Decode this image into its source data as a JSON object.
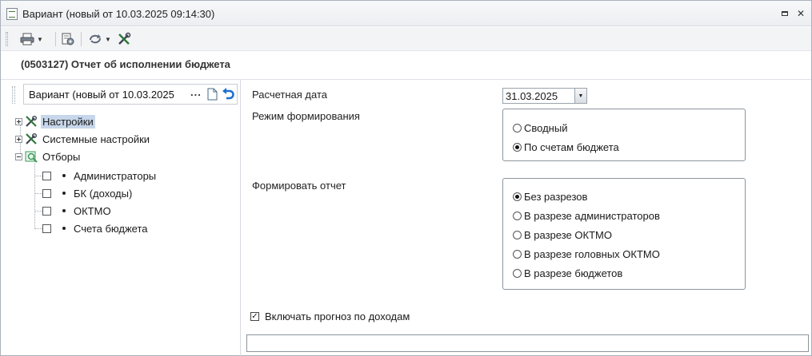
{
  "window": {
    "title": "Вариант (новый от 10.03.2025 09:14:30)",
    "restore_glyph": "▫",
    "close_glyph": "✕"
  },
  "toolbar": {
    "items": [
      {
        "icon": "printer-icon",
        "has_dropdown": true
      },
      {
        "icon": "settings-sheet-icon",
        "has_dropdown": false
      },
      {
        "icon": "refresh-options-icon",
        "has_dropdown": true
      },
      {
        "icon": "tools-icon",
        "has_dropdown": false
      }
    ]
  },
  "report": {
    "title": "(0503127) Отчет об исполнении бюджета"
  },
  "left_panel": {
    "variant_value": "Вариант (новый от 10.03.2025",
    "ellipsis": "...",
    "tree": [
      {
        "label": "Настройки",
        "icon": "tools-icon",
        "expandable": true,
        "selected": true
      },
      {
        "label": "Системные настройки",
        "icon": "tools-icon",
        "expandable": true,
        "selected": false
      },
      {
        "label": "Отборы",
        "icon": "filter-icon",
        "expandable": true,
        "expanded": true,
        "selected": false,
        "children": [
          {
            "label": "Администраторы",
            "checked": false
          },
          {
            "label": "БК (доходы)",
            "checked": false
          },
          {
            "label": "ОКТМО",
            "checked": false
          },
          {
            "label": "Счета бюджета",
            "checked": false
          }
        ]
      }
    ]
  },
  "right_panel": {
    "calc_date_label": "Расчетная дата",
    "calc_date_value": "31.03.2025",
    "mode_label": "Режим формирования",
    "mode_options": [
      {
        "label": "Сводный",
        "selected": false
      },
      {
        "label": "По счетам бюджета",
        "selected": true
      }
    ],
    "form_label": "Формировать отчет",
    "form_options": [
      {
        "label": "Без разрезов",
        "selected": true
      },
      {
        "label": "В разрезе администраторов",
        "selected": false
      },
      {
        "label": "В разрезе ОКТМО",
        "selected": false
      },
      {
        "label": "В разрезе головных ОКТМО",
        "selected": false
      },
      {
        "label": "В разрезе бюджетов",
        "selected": false
      }
    ],
    "forecast_label": "Включать прогноз по доходам",
    "forecast_checked": true,
    "check_glyph": "✓",
    "status_value": ""
  },
  "colors": {
    "selection": "#c7d6ea",
    "undo_arrow": "#1a6fd0",
    "filter_icon": "#3d9a5a"
  }
}
